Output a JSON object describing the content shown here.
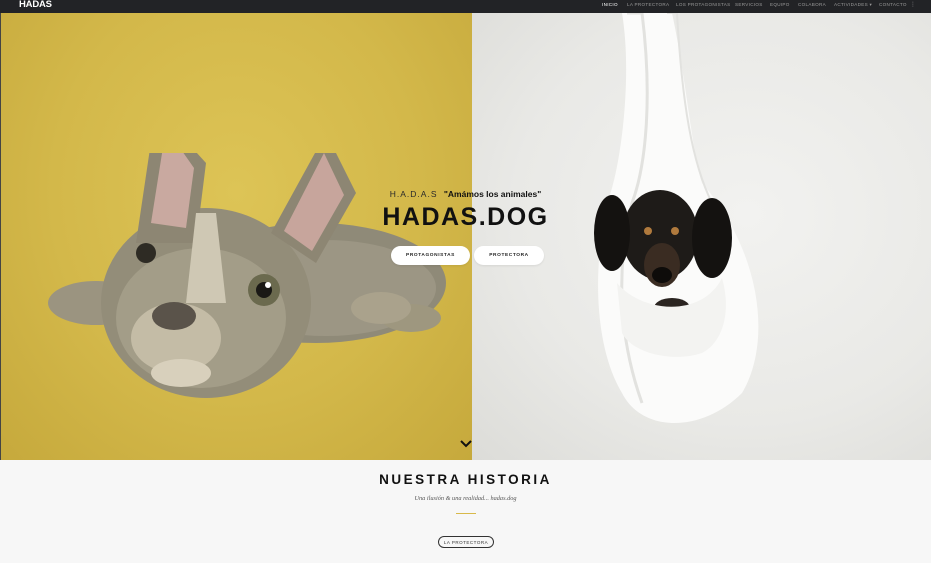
{
  "nav": {
    "logo": "HADAS",
    "items": [
      {
        "label": "INICIO",
        "active": true
      },
      {
        "label": "LA PROTECTORA",
        "active": false
      },
      {
        "label": "LOS PROTAGONISTAS",
        "active": false
      },
      {
        "label": "SERVICIOS",
        "active": false
      },
      {
        "label": "EQUIPO",
        "active": false
      },
      {
        "label": "COLABORA",
        "active": false
      },
      {
        "label": "ACTIVIDADES ▾",
        "active": false
      },
      {
        "label": "CONTACTO",
        "active": false
      }
    ],
    "more_icon": "kebab-icon",
    "more_glyph": "⋮"
  },
  "hero": {
    "brand_small": "H.A.D.A.S",
    "motto": "\"Amámos los animales\"",
    "title": "HADAS.DOG",
    "button_protagonistas": "PROTAGONISTAS",
    "button_protectora": "PROTECTORA",
    "left_bg": "#d5ba4b",
    "right_bg": "#ececea"
  },
  "section": {
    "title": "NUESTRA HISTORIA",
    "subtitle": "Una ilusión & una realidad... hadas.dog",
    "button": "LA PROTECTORA",
    "accent": "#d8b94a"
  }
}
